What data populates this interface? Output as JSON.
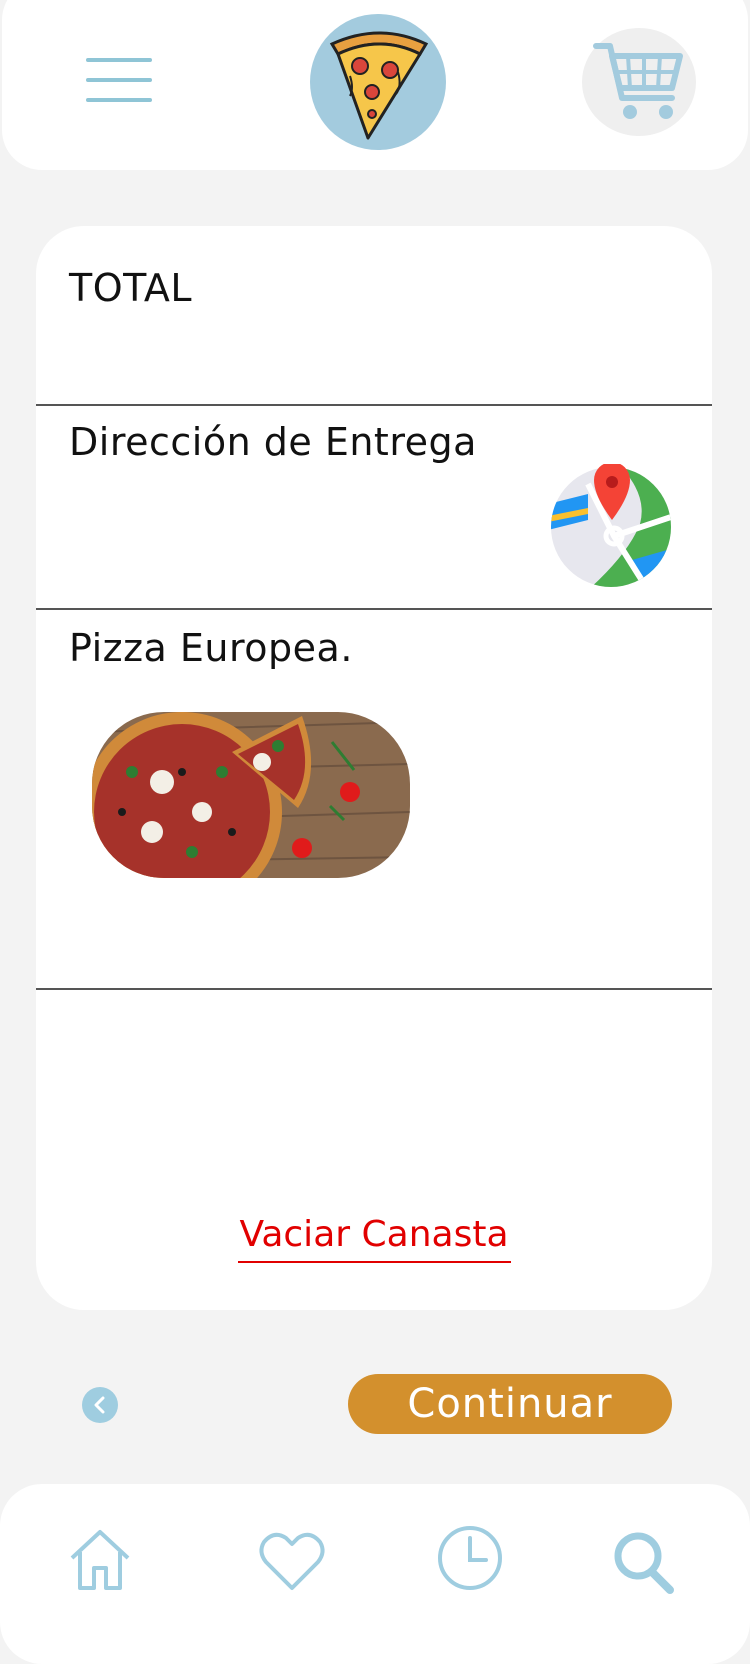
{
  "header": {
    "menu_icon": "hamburger-menu-icon",
    "logo_icon": "pizza-slice-logo",
    "cart_icon": "shopping-cart-icon"
  },
  "card": {
    "total_label": "TOTAL",
    "delivery_label": "Dirección de Entrega",
    "map_icon": "map-location-icon",
    "item_name": "Pizza Europea.",
    "clear_basket_label": "Vaciar Canasta"
  },
  "actions": {
    "back_icon": "chevron-left-icon",
    "continue_label": "Continuar"
  },
  "bottom_nav": {
    "items": [
      "home-icon",
      "heart-icon",
      "clock-icon",
      "search-icon"
    ]
  },
  "colors": {
    "accent_blue": "#8fc5d6",
    "continue_orange": "#d3902d",
    "danger_red": "#e10000",
    "background": "#f3f3f3"
  }
}
